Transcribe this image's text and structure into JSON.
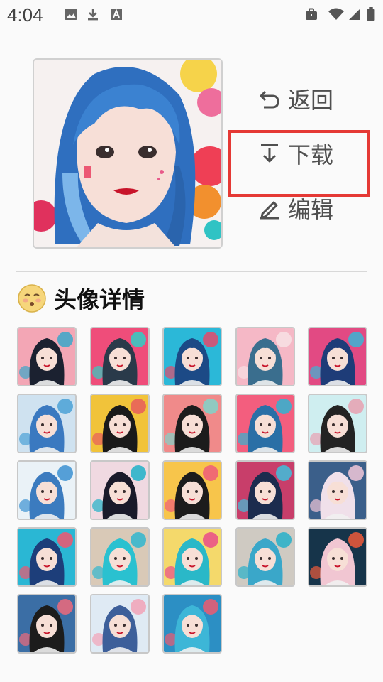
{
  "status_bar": {
    "time": "4:04",
    "left_icons": [
      "image-icon",
      "download-icon",
      "font-icon"
    ],
    "right_icons": [
      "briefcase-icon",
      "wifi-icon",
      "signal-icon",
      "battery-icon"
    ]
  },
  "actions": {
    "back_label": "返回",
    "download_label": "下载",
    "edit_label": "编辑",
    "highlight_color": "#e53935"
  },
  "section": {
    "title": "头像详情",
    "emoji_icon": "shy-face-icon"
  },
  "thumbnails": [
    {
      "bg": "#f3a6b5",
      "accent": "#3aa7c9",
      "hair": "#1b2130"
    },
    {
      "bg": "#ef4d7a",
      "accent": "#2ed0c5",
      "hair": "#2a3a4a"
    },
    {
      "bg": "#2bb8d8",
      "accent": "#e5496b",
      "hair": "#1c4a86"
    },
    {
      "bg": "#f5b8c6",
      "accent": "#f7e0e4",
      "hair": "#3a6e8e"
    },
    {
      "bg": "#e24a83",
      "accent": "#3ab5d6",
      "hair": "#1e3c78"
    },
    {
      "bg": "#cfe2f0",
      "accent": "#4aa1d6",
      "hair": "#3a79c0"
    },
    {
      "bg": "#f1c33a",
      "accent": "#e85d5d",
      "hair": "#1a1a1a"
    },
    {
      "bg": "#f08a8a",
      "accent": "#7fd3c9",
      "hair": "#1c1c1c"
    },
    {
      "bg": "#f35e7e",
      "accent": "#2fb4d1",
      "hair": "#2a6fa6"
    },
    {
      "bg": "#cfeef0",
      "accent": "#e8a0b0",
      "hair": "#232323"
    },
    {
      "bg": "#eaf2f7",
      "accent": "#3b91d1",
      "hair": "#3b7bbf"
    },
    {
      "bg": "#f0d9e1",
      "accent": "#1fb0c8",
      "hair": "#1a1a2a"
    },
    {
      "bg": "#f7c54b",
      "accent": "#ef5b7a",
      "hair": "#1c1c1c"
    },
    {
      "bg": "#c83e6a",
      "accent": "#3ec0dc",
      "hair": "#1c2c4e"
    },
    {
      "bg": "#3b5f8a",
      "accent": "#f2c8d8",
      "hair": "#f0e0ea"
    },
    {
      "bg": "#2ab7d4",
      "accent": "#f1566f",
      "hair": "#1d3e7a"
    },
    {
      "bg": "#d9c9b7",
      "accent": "#2fb6cf",
      "hair": "#2ac1d0"
    },
    {
      "bg": "#f4d96b",
      "accent": "#e94b8a",
      "hair": "#2ab8c8"
    },
    {
      "bg": "#cfcac2",
      "accent": "#26b0c9",
      "hair": "#3aa7c9"
    },
    {
      "bg": "#16344a",
      "accent": "#ee5b3a",
      "hair": "#f1c6d2"
    },
    {
      "bg": "#3b6ea5",
      "accent": "#f06a7a",
      "hair": "#1c1c1c"
    },
    {
      "bg": "#dfeaf4",
      "accent": "#f2a2b6",
      "hair": "#3d5f9a"
    },
    {
      "bg": "#2c8fc4",
      "accent": "#f05a70",
      "hair": "#3db6d7"
    }
  ]
}
